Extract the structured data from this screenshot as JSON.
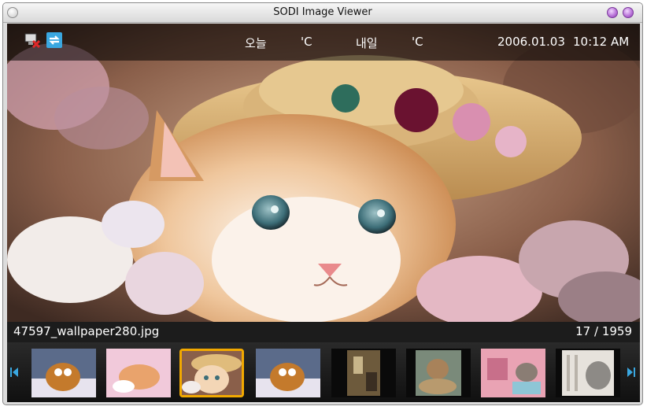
{
  "window": {
    "title": "SODI Image Viewer"
  },
  "header": {
    "today_label": "오늘",
    "today_temp": "'C",
    "tomorrow_label": "내일",
    "tomorrow_temp": "'C",
    "date": "2006.01.03",
    "time": "10:12 AM",
    "icons": [
      "disconnected-display-icon",
      "refresh-icon"
    ]
  },
  "photo": {
    "subject": "kitten-with-straw-hat"
  },
  "info": {
    "filename": "47597_wallpaper280.jpg",
    "counter": "17 / 1959"
  },
  "thumbnails": [
    {
      "name": "thumb-cat-on-bed",
      "selected": false
    },
    {
      "name": "thumb-kitten-sleeping-pink",
      "selected": false
    },
    {
      "name": "thumb-kitten-straw-hat",
      "selected": true
    },
    {
      "name": "thumb-cat-on-bed-2",
      "selected": false
    },
    {
      "name": "thumb-room-interior",
      "selected": false
    },
    {
      "name": "thumb-cat-in-basket",
      "selected": false
    },
    {
      "name": "thumb-kitten-pink-room",
      "selected": false
    },
    {
      "name": "thumb-cat-radiator",
      "selected": false
    }
  ],
  "colors": {
    "selection": "#f2a900",
    "accent": "#3aa7e0"
  }
}
